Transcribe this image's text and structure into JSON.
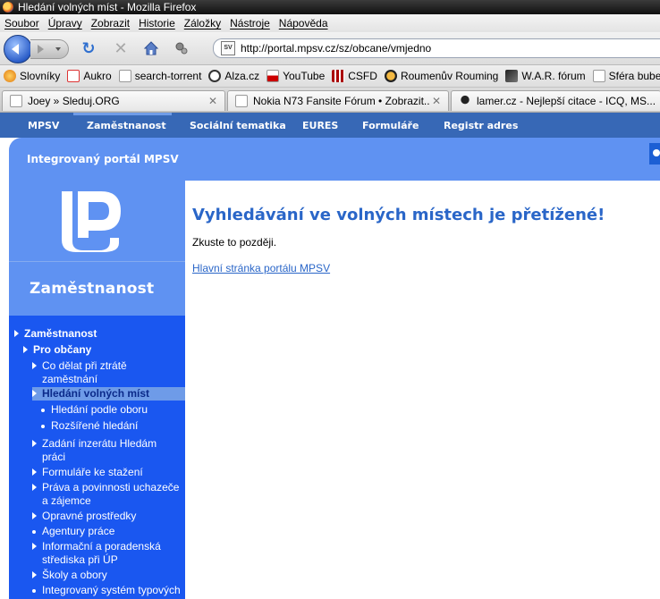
{
  "window": {
    "title": "Hledání volných míst - Mozilla Firefox"
  },
  "menu": [
    "Soubor",
    "Úpravy",
    "Zobrazit",
    "Historie",
    "Záložky",
    "Nástroje",
    "Nápověda"
  ],
  "nav": {
    "url": "http://portal.mpsv.cz/sz/obcane/vmjedno",
    "site_icon_text": "SV"
  },
  "bookmarks": [
    {
      "label": "Slovníky",
      "icon": "folder-icon",
      "color": "#f0a020"
    },
    {
      "label": "Aukro",
      "icon": "aukro-icon",
      "color": "#d33"
    },
    {
      "label": "search-torrent",
      "icon": "page-icon",
      "color": "#ffffff"
    },
    {
      "label": "Alza.cz",
      "icon": "alza-icon",
      "color": "#333"
    },
    {
      "label": "YouTube",
      "icon": "youtube-icon",
      "color": "#c00"
    },
    {
      "label": "CSFD",
      "icon": "csfd-icon",
      "color": "#a00"
    },
    {
      "label": "Roumenův Rouming",
      "icon": "rouming-icon",
      "color": "#222"
    },
    {
      "label": "W.A.R. fórum",
      "icon": "war-icon",
      "color": "#444"
    },
    {
      "label": "Sféra bube",
      "icon": "page-icon",
      "color": "#ffffff"
    }
  ],
  "tabs": [
    {
      "label": "Joey » Sleduj.ORG",
      "icon": "page-icon"
    },
    {
      "label": "Nokia N73 Fansite Fórum • Zobrazit...",
      "icon": "page-icon"
    },
    {
      "label": "lamer.cz - Nejlepší citace - ICQ, MS...",
      "icon": "lamer-icon"
    }
  ],
  "site_nav": [
    "MPSV",
    "Zaměstnanost",
    "Sociální tematika",
    "EURES",
    "Formuláře",
    "Registr adres"
  ],
  "portal_title": "Integrovaný portál MPSV",
  "section_title": "Zaměstnanost",
  "sidebar": {
    "items": [
      "Zaměstnanost",
      "Pro občany",
      "Co dělat při ztrátě zaměstnání",
      "Hledání volných míst",
      "Hledání podle oboru",
      "Rozšířené hledání",
      "Zadání inzerátu Hledám práci",
      "Formuláře ke stažení",
      "Práva a povinnosti uchazeče a zájemce",
      "Opravné prostředky",
      "Agentury práce",
      "Informační a poradenská střediska při ÚP",
      "Školy a obory",
      "Integrovaný systém typových"
    ]
  },
  "main": {
    "heading": "Vyhledávání ve volných místech je přetížené!",
    "message": "Zkuste to později.",
    "link": "Hlavní stránka portálu MPSV"
  },
  "colors": {
    "nav_bar": "#3768b6",
    "band": "#5f92f2",
    "sidebar": "#1a57f0",
    "heading": "#2a66c8"
  }
}
